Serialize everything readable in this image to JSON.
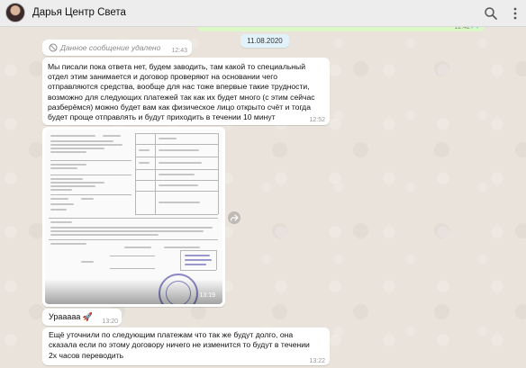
{
  "header": {
    "contact_name": "Дарья Центр Света",
    "icons": [
      "search-icon",
      "menu-icon"
    ]
  },
  "previous_outgoing": {
    "time": "12:42"
  },
  "date_separator": "11.08.2020",
  "messages": [
    {
      "type": "deleted",
      "text": "Данное сообщение удалено",
      "time": "12:43",
      "icon": "ban-icon"
    },
    {
      "type": "text",
      "text": "Мы писали пока ответа нет, будем заводить, там какой то специальный отдел этим занимается и договор проверяют на основании чего отправляются средства, вообще для нас тоже впервые такие трудности, возможно для следующих платежей так как их будет много (с этим сейчас разберёмся) можно будет вам как физическое лицо открыто счёт и тогда будет проще отправлять и будут приходить в течении 10 минут",
      "time": "12:52"
    },
    {
      "type": "image",
      "content": "document-photo",
      "time": "13:19"
    },
    {
      "type": "text",
      "text": "Урааааа 🚀",
      "time": "13:20"
    },
    {
      "type": "text",
      "text": "Ещё уточнили по следующим платежам что так же будут долго, она сказала если по этому договору ничего не изменится то будут в течении 2х часов переводить",
      "time": "13:22"
    }
  ],
  "colors": {
    "chat_bg": "#e9e3dc",
    "incoming_bubble": "#ffffff",
    "outgoing_bubble": "#dcf8c6",
    "header_bg": "#ededed",
    "date_chip": "#e1f2fb"
  }
}
